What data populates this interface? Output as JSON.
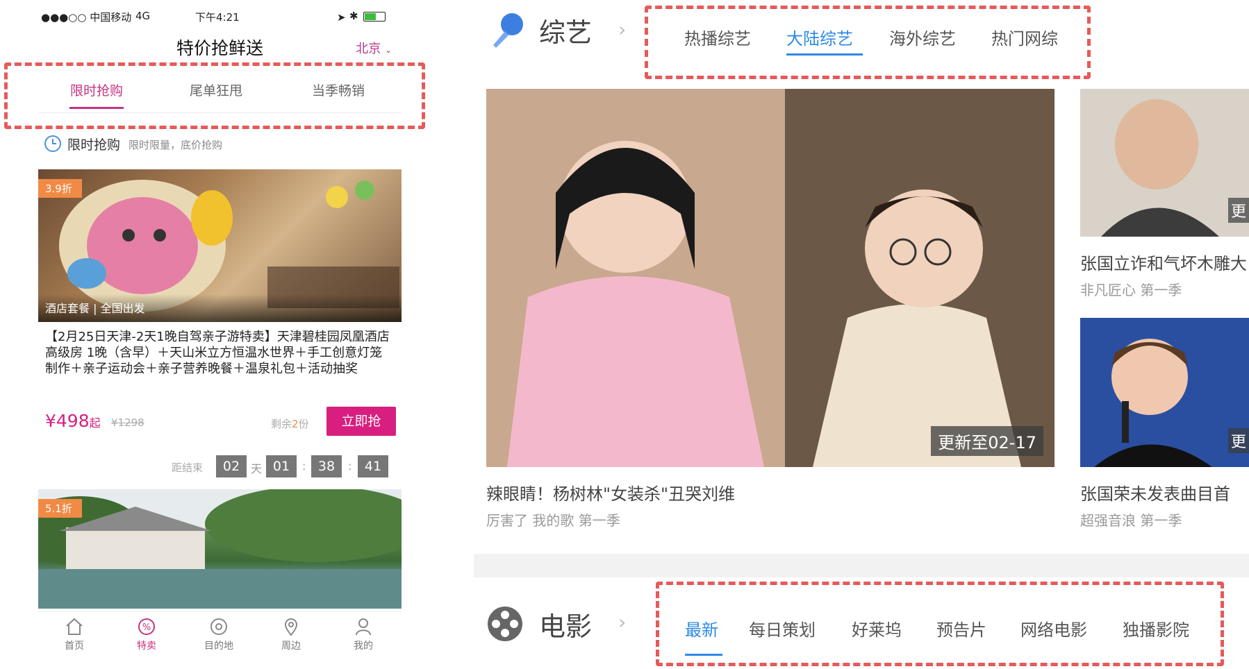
{
  "phone": {
    "status": {
      "carrier": "●●●○○ 中国移动",
      "network": "4G",
      "time": "下午4:21"
    },
    "nav": {
      "title": "特价抢鲜送",
      "city": "北京"
    },
    "tabs": [
      {
        "label": "限时抢购",
        "active": true
      },
      {
        "label": "尾单狂甩",
        "active": false
      },
      {
        "label": "当季畅销",
        "active": false
      }
    ],
    "section": {
      "title": "限时抢购",
      "subtitle": "限时限量，底价抢购"
    },
    "deal1": {
      "badge": "3.9折",
      "image_caption": "酒店套餐 | 全国出发",
      "description": "【2月25日天津-2天1晚自驾亲子游特卖】天津碧桂园凤凰酒店高级房 1晚（含早）＋天山米立方恒温水世界＋手工创意灯笼制作＋亲子运动会＋亲子营养晚餐＋温泉礼包＋活动抽奖",
      "price": "¥498",
      "price_suffix": "起",
      "original_price": "¥1298",
      "remaining_prefix": "剩余",
      "remaining_count": "2",
      "remaining_suffix": "份",
      "buy_label": "立即抢",
      "countdown_label": "距结束",
      "countdown": {
        "days": "02",
        "day_unit": "天",
        "hours": "01",
        "minutes": "38",
        "seconds": "41",
        "sep": ":"
      }
    },
    "deal2": {
      "badge": "5.1折"
    },
    "tabbar": [
      {
        "label": "首页",
        "icon": "home-icon",
        "active": false
      },
      {
        "label": "特卖",
        "icon": "discount-icon",
        "active": true
      },
      {
        "label": "目的地",
        "icon": "destination-icon",
        "active": false
      },
      {
        "label": "周边",
        "icon": "location-pin-icon",
        "active": false
      },
      {
        "label": "我的",
        "icon": "user-icon",
        "active": false
      }
    ],
    "accent": "#c5337f"
  },
  "web": {
    "variety": {
      "title": "综艺",
      "tabs": [
        {
          "label": "热播综艺",
          "active": false
        },
        {
          "label": "大陆综艺",
          "active": true
        },
        {
          "label": "海外综艺",
          "active": false
        },
        {
          "label": "热门网综",
          "active": false
        }
      ],
      "main": {
        "update_badge": "更新至02-17",
        "title": "辣眼睛！杨树林\"女装杀\"丑哭刘维",
        "subtitle": "厉害了 我的歌 第一季"
      },
      "side1": {
        "title": "张国立诈和气坏木雕大",
        "subtitle": "非凡匠心 第一季",
        "badge": "更"
      },
      "side2": {
        "title": "张国荣未发表曲目首",
        "subtitle": "超强音浪 第一季",
        "badge": "更"
      }
    },
    "movie": {
      "title": "电影",
      "tabs": [
        {
          "label": "最新",
          "active": true
        },
        {
          "label": "每日策划",
          "active": false
        },
        {
          "label": "好莱坞",
          "active": false
        },
        {
          "label": "预告片",
          "active": false
        },
        {
          "label": "网络电影",
          "active": false
        },
        {
          "label": "独播影院",
          "active": false
        }
      ]
    },
    "accent": "#2e8ae6",
    "highlight_color": "#e55a5a"
  }
}
